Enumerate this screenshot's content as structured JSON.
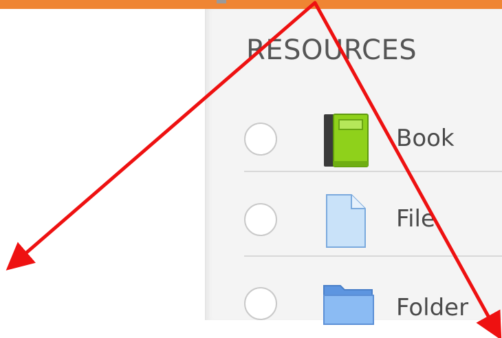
{
  "colors": {
    "top_bar": "#ef8533",
    "panel_bg": "#f4f4f4",
    "arrow": "#ee1111",
    "book_green": "#8fd11b",
    "file_blue": "#c9e2f9",
    "folder_blue": "#7fb2ef"
  },
  "resources": {
    "title": "RESOURCES",
    "items": [
      {
        "label": "Book",
        "icon": "book-icon",
        "selected": false
      },
      {
        "label": "File",
        "icon": "file-icon",
        "selected": false
      },
      {
        "label": "Folder",
        "icon": "folder-icon",
        "selected": false
      }
    ]
  }
}
